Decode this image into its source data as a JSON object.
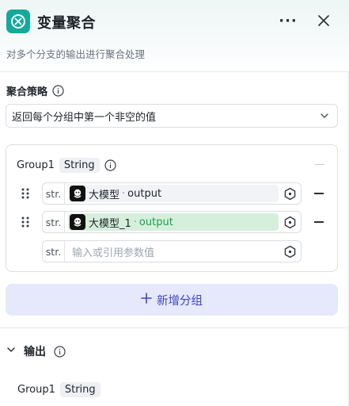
{
  "header": {
    "title": "变量聚合",
    "more_label": "···",
    "description": "对多个分支的输出进行聚合处理"
  },
  "strategy": {
    "label": "聚合策略",
    "selected": "返回每个分组中第一个非空的值"
  },
  "group": {
    "name": "Group1",
    "type": "String",
    "variables": [
      {
        "type_tag": "str.",
        "node": "大模型",
        "sep": "·",
        "output": "output",
        "highlighted": false
      },
      {
        "type_tag": "str.",
        "node": "大模型_1",
        "sep": "·",
        "output": "output",
        "highlighted": true
      }
    ],
    "empty_input": {
      "type_tag": "str.",
      "placeholder": "输入或引用参数值"
    }
  },
  "add_group_label": "新增分组",
  "output": {
    "label": "输出",
    "group_name": "Group1",
    "group_type": "String"
  },
  "colors": {
    "node_icon": "#14a99b",
    "accent": "#3b47c4",
    "add_group_bg": "#e6e8fb",
    "highlight_chip": "#d6efdc",
    "highlight_text": "#1b9e4b"
  }
}
